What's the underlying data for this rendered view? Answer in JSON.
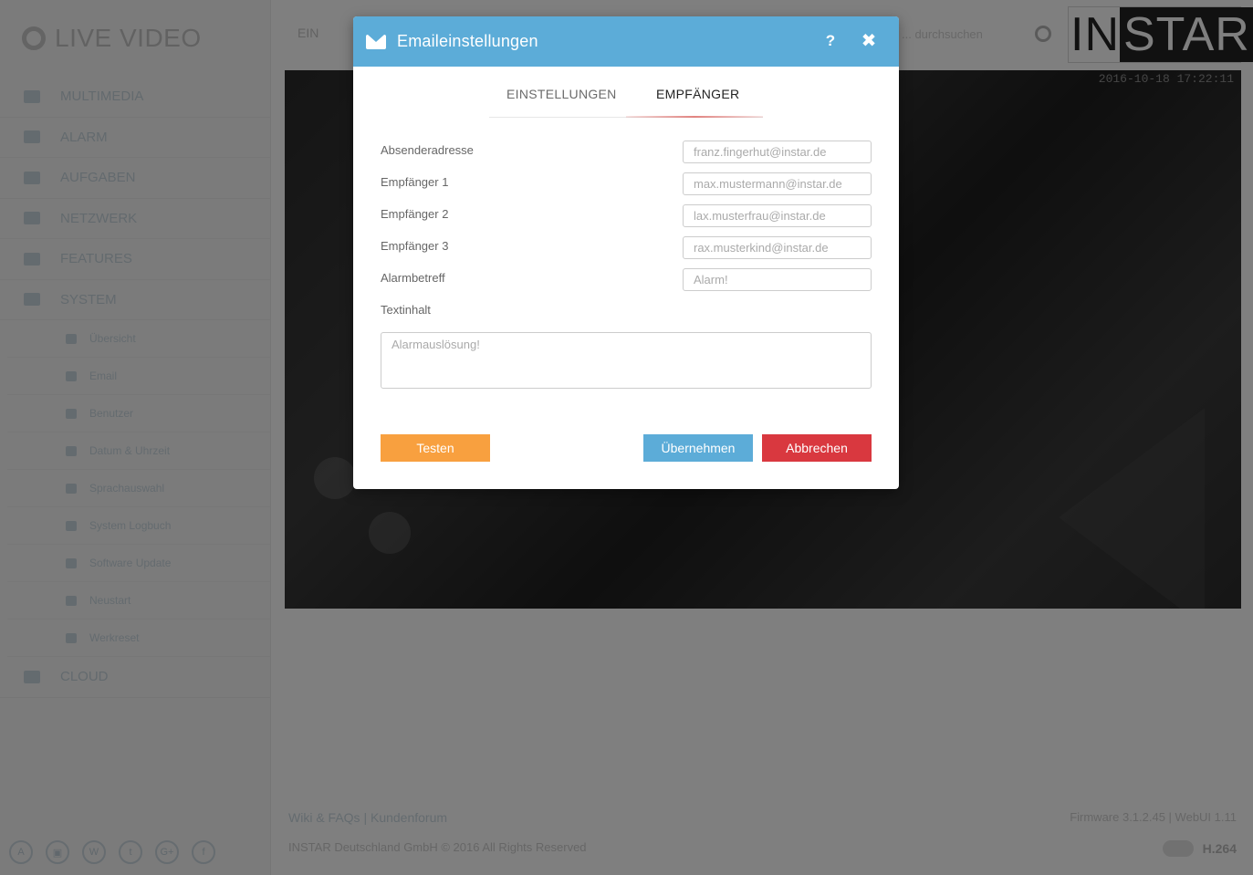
{
  "app": {
    "title": "LIVE VIDEO",
    "nav": [
      {
        "label": "MULTIMEDIA",
        "icon": "image-icon"
      },
      {
        "label": "ALARM",
        "icon": "bell-icon"
      },
      {
        "label": "AUFGABEN",
        "icon": "film-icon"
      },
      {
        "label": "NETZWERK",
        "icon": "network-icon"
      },
      {
        "label": "FEATURES",
        "icon": "star-icon"
      },
      {
        "label": "SYSTEM",
        "icon": "gear-icon"
      }
    ],
    "system_sub": [
      {
        "label": "Übersicht",
        "icon": "monitor-icon"
      },
      {
        "label": "Email",
        "icon": "mail-icon"
      },
      {
        "label": "Benutzer",
        "icon": "user-icon"
      },
      {
        "label": "Datum & Uhrzeit",
        "icon": "clock-icon"
      },
      {
        "label": "Sprachauswahl",
        "icon": "globe-icon"
      },
      {
        "label": "System Logbuch",
        "icon": "book-icon"
      },
      {
        "label": "Software Update",
        "icon": "refresh-icon"
      },
      {
        "label": "Neustart",
        "icon": "power-icon"
      },
      {
        "label": "Werkreset",
        "icon": "wrench-icon"
      }
    ],
    "cloud": {
      "label": "CLOUD",
      "icon": "cloud-icon"
    },
    "social": [
      "A",
      "▣",
      "W",
      "t",
      "G+",
      "f"
    ],
    "topbar": {
      "tab_label": "EIN",
      "search_placeholder": "... durchsuchen"
    },
    "brand": {
      "part1": "IN",
      "part2": "STAR"
    },
    "video_timestamp": "2016-10-18 17:22:11",
    "footer": {
      "links": "Wiki & FAQs | Kundenforum",
      "copyright": "INSTAR Deutschland GmbH © 2016 All Rights Reserved",
      "firmware": "Firmware 3.1.2.45 | WebUI 1.11",
      "codec": "H.264"
    }
  },
  "modal": {
    "title": "Emaileinstellungen",
    "help_label": "?",
    "close_label": "✖",
    "tabs": [
      {
        "label": "EINSTELLUNGEN",
        "active": false
      },
      {
        "label": "EMPFÄNGER",
        "active": true
      }
    ],
    "fields": [
      {
        "label": "Absenderadresse",
        "placeholder": "franz.fingerhut@instar.de"
      },
      {
        "label": "Empfänger 1",
        "placeholder": "max.mustermann@instar.de"
      },
      {
        "label": "Empfänger 2",
        "placeholder": "lax.musterfrau@instar.de"
      },
      {
        "label": "Empfänger 3",
        "placeholder": "rax.musterkind@instar.de"
      },
      {
        "label": "Alarmbetreff",
        "placeholder": "Alarm!"
      }
    ],
    "text_label": "Textinhalt",
    "text_placeholder": "Alarmauslösung!",
    "buttons": {
      "test": "Testen",
      "apply": "Übernehmen",
      "cancel": "Abbrechen"
    },
    "colors": {
      "header": "#5cacd8",
      "test": "#f8a03f",
      "apply": "#5cacd8",
      "cancel": "#d9383f"
    }
  }
}
